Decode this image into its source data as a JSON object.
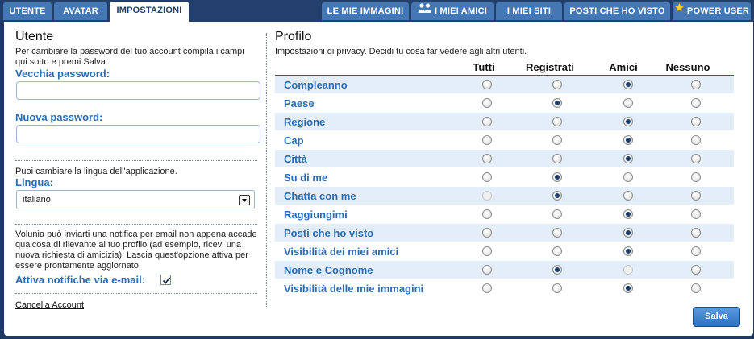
{
  "tabs_left": [
    {
      "label": "UTENTE",
      "active": false
    },
    {
      "label": "AVATAR",
      "active": false
    },
    {
      "label": "IMPOSTAZIONI",
      "active": true
    }
  ],
  "tabs_right": [
    {
      "label": "LE MIE IMMAGINI",
      "icon": ""
    },
    {
      "label": "I MIEI AMICI",
      "icon": "friends-icon"
    },
    {
      "label": "I MIEI SITI",
      "icon": ""
    },
    {
      "label": "POSTI CHE HO VISTO",
      "icon": ""
    },
    {
      "label": "POWER USER",
      "icon": "star-icon"
    }
  ],
  "utente": {
    "title": "Utente",
    "help_password": "Per cambiare la password del tuo account compila i campi qui sotto e premi Salva.",
    "old_password_label": "Vecchia password:",
    "old_password_value": "",
    "new_password_label": "Nuova password:",
    "new_password_value": "",
    "help_language": "Puoi cambiare la lingua dell'applicazione.",
    "language_label": "Lingua:",
    "language_value": "italiano",
    "help_notify": "Volunia può inviarti una notifica per email non appena accade qualcosa di rilevante al tuo profilo (ad esempio, ricevi una nuova richiesta di amicizia). Lascia quest'opzione attiva per essere prontamente aggiornato.",
    "notify_label": "Attiva notifiche via e-mail:",
    "notify_checked": true,
    "delete_account": "Cancella Account"
  },
  "profilo": {
    "title": "Profilo",
    "subtitle": "Impostazioni di privacy. Decidi tu cosa far vedere agli altri utenti.",
    "columns": [
      "Tutti",
      "Registrati",
      "Amici",
      "Nessuno"
    ],
    "rows": [
      {
        "name": "Compleanno",
        "selected": 2,
        "disabled": []
      },
      {
        "name": "Paese",
        "selected": 1,
        "disabled": []
      },
      {
        "name": "Regione",
        "selected": 2,
        "disabled": []
      },
      {
        "name": "Cap",
        "selected": 2,
        "disabled": []
      },
      {
        "name": "Città",
        "selected": 2,
        "disabled": []
      },
      {
        "name": "Su di me",
        "selected": 1,
        "disabled": []
      },
      {
        "name": "Chatta con me",
        "selected": 1,
        "disabled": [
          0
        ]
      },
      {
        "name": "Raggiungimi",
        "selected": 2,
        "disabled": []
      },
      {
        "name": "Posti che ho visto",
        "selected": 2,
        "disabled": []
      },
      {
        "name": "Visibilità dei miei amici",
        "selected": 2,
        "disabled": []
      },
      {
        "name": "Nome e Cognome",
        "selected": 1,
        "disabled": [
          2
        ]
      },
      {
        "name": "Visibilità delle mie immagini",
        "selected": 2,
        "disabled": []
      }
    ],
    "save_label": "Salva"
  }
}
